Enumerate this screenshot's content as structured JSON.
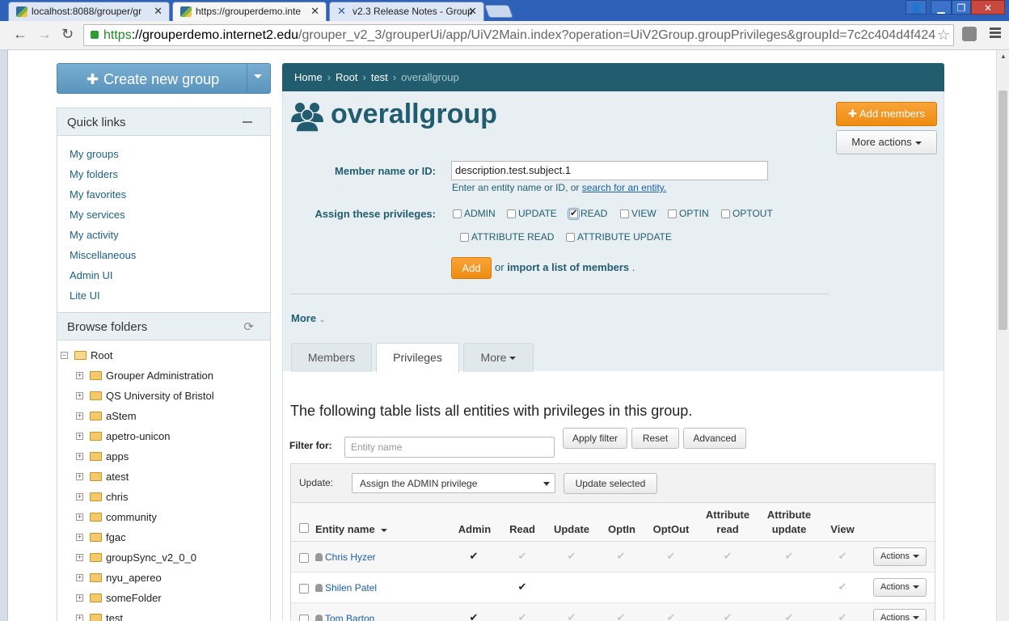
{
  "browser": {
    "tabs": [
      {
        "title": "localhost:8088/grouper/gr",
        "active": false
      },
      {
        "title": "https://grouperdemo.inte",
        "active": true
      },
      {
        "title": "v2.3 Release Notes - Group",
        "active": false
      }
    ],
    "url_scheme": "https",
    "url_host": "://grouperdemo.internet2.edu",
    "url_path": "/grouper_v2_3/grouperUi/app/UiV2Main.index?operation=UiV2Group.groupPrivileges&groupId=7c2c404d4f424"
  },
  "sidebar": {
    "create_group_label": "Create new group",
    "quick_links_title": "Quick links",
    "quick_links": [
      "My groups",
      "My folders",
      "My favorites",
      "My services",
      "My activity",
      "Miscellaneous",
      "Admin UI",
      "Lite UI"
    ],
    "browse_title": "Browse folders",
    "root_label": "Root",
    "folders": [
      "Grouper Administration",
      "QS University of Bristol",
      "aStem",
      "apetro-unicon",
      "apps",
      "atest",
      "chris",
      "community",
      "fgac",
      "groupSync_v2_0_0",
      "nyu_apereo",
      "someFolder",
      "test"
    ]
  },
  "breadcrumb": {
    "items": [
      "Home",
      "Root",
      "test"
    ],
    "current": "overallgroup"
  },
  "group": {
    "title": "overallgroup",
    "add_members_label": "Add members",
    "more_actions_label": "More actions"
  },
  "form": {
    "member_label": "Member name or ID:",
    "member_value": "description.test.subject.1",
    "help_text": "Enter an entity name or ID, or ",
    "help_link": "search for an entity.",
    "assign_label": "Assign these privileges:",
    "privileges": [
      {
        "label": "ADMIN",
        "checked": false
      },
      {
        "label": "UPDATE",
        "checked": false
      },
      {
        "label": "READ",
        "checked": true
      },
      {
        "label": "VIEW",
        "checked": false
      },
      {
        "label": "OPTIN",
        "checked": false
      },
      {
        "label": "OPTOUT",
        "checked": false
      },
      {
        "label": "ATTRIBUTE READ",
        "checked": false
      },
      {
        "label": "ATTRIBUTE UPDATE",
        "checked": false
      }
    ],
    "add_label": "Add",
    "or_text": "or",
    "import_text": "import a list of members",
    "import_suffix": ".",
    "more_label": "More"
  },
  "page_tabs": [
    {
      "label": "Members",
      "active": false
    },
    {
      "label": "Privileges",
      "active": true
    },
    {
      "label": "More",
      "active": false
    }
  ],
  "table": {
    "title": "The following table lists all entities with privileges in this group.",
    "filter_label": "Filter for:",
    "filter_placeholder": "Entity name",
    "apply_label": "Apply filter",
    "reset_label": "Reset",
    "advanced_label": "Advanced",
    "update_label": "Update:",
    "update_value": "Assign the ADMIN privilege",
    "update_selected_label": "Update selected",
    "columns": [
      "Entity name",
      "Admin",
      "Read",
      "Update",
      "OptIn",
      "OptOut",
      "Attribute read",
      "Attribute update",
      "View"
    ],
    "rows": [
      {
        "name": "Chris Hyzer",
        "privs": [
          "on",
          "dim",
          "dim",
          "dim",
          "dim",
          "dim",
          "dim",
          "dim"
        ]
      },
      {
        "name": "Shilen Patel",
        "privs": [
          "",
          "on",
          "",
          "",
          "",
          "",
          "",
          "dim"
        ]
      },
      {
        "name": "Tom Barton",
        "privs": [
          "on",
          "dim",
          "dim",
          "dim",
          "dim",
          "dim",
          "dim",
          "dim"
        ]
      }
    ],
    "actions_label": "Actions"
  },
  "colors": {
    "accent": "#225d6f",
    "orange": "#f0901a",
    "link": "#1e6185"
  }
}
